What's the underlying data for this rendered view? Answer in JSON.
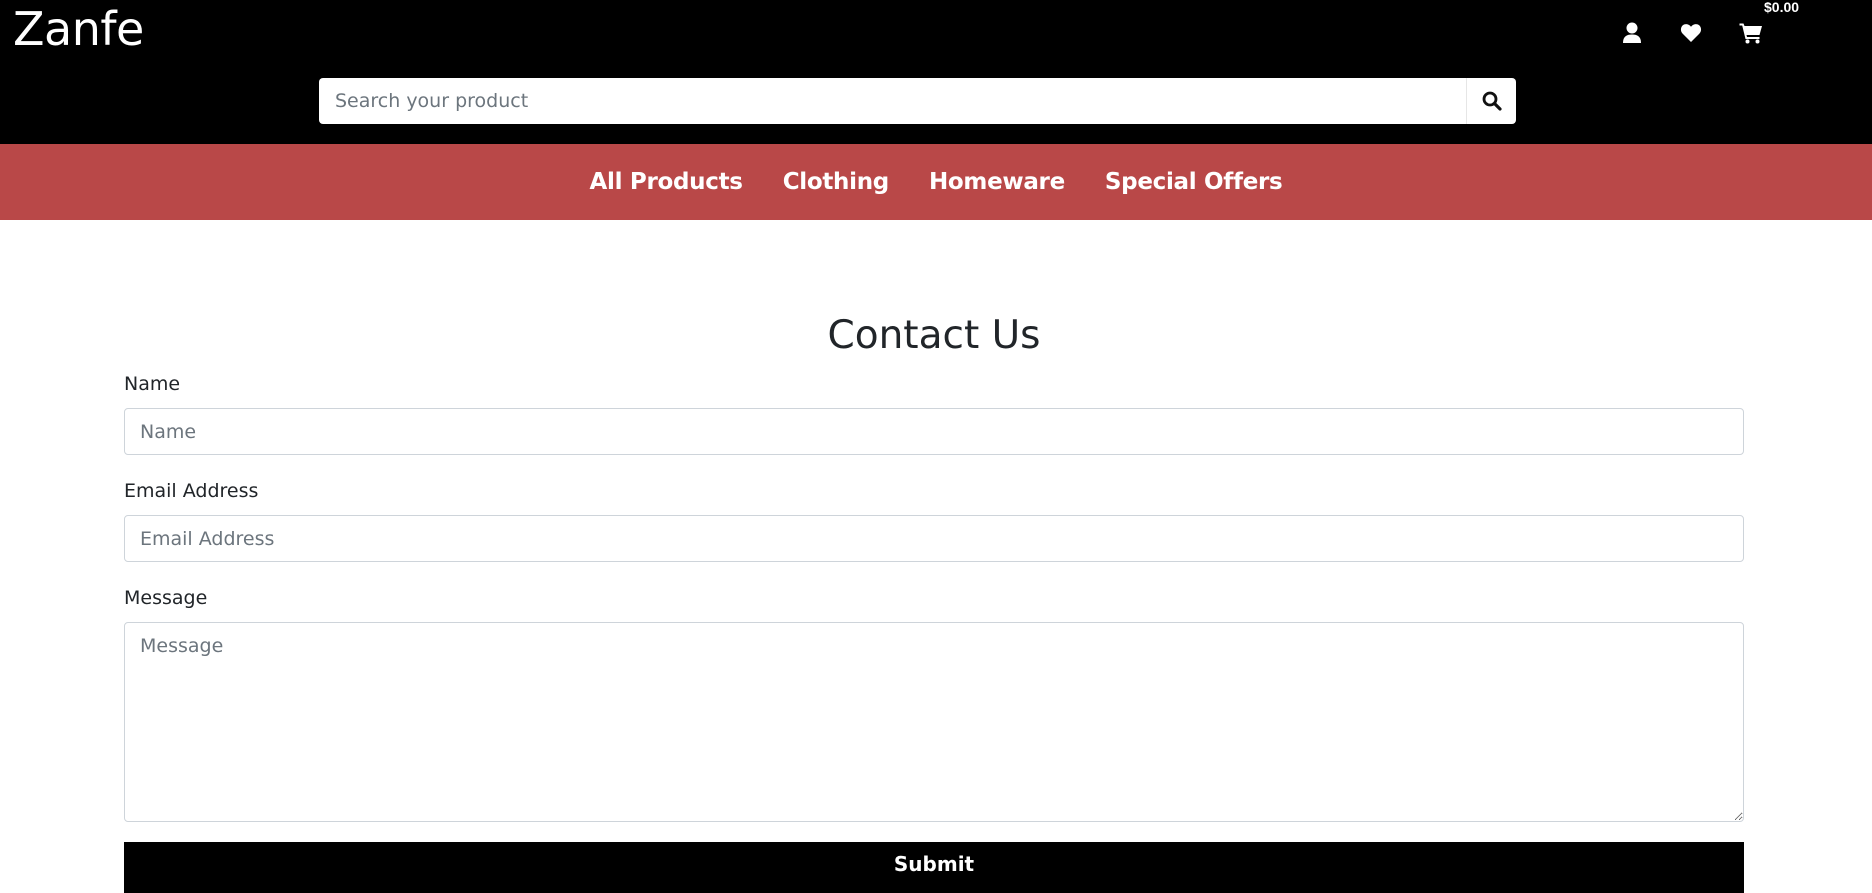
{
  "header": {
    "logo": "Zanfe",
    "cart_total": "$0.00",
    "icons": [
      "user-icon",
      "heart-icon",
      "cart-icon"
    ],
    "background": "#000000"
  },
  "search": {
    "placeholder": "Search your product",
    "value": "",
    "icon": "search-icon"
  },
  "nav": {
    "background": "#b94848",
    "items": [
      {
        "label": "All Products"
      },
      {
        "label": "Clothing"
      },
      {
        "label": "Homeware"
      },
      {
        "label": "Special Offers"
      }
    ]
  },
  "main": {
    "title": "Contact Us",
    "form": {
      "name": {
        "label": "Name",
        "placeholder": "Name",
        "value": ""
      },
      "email": {
        "label": "Email Address",
        "placeholder": "Email Address",
        "value": ""
      },
      "message": {
        "label": "Message",
        "placeholder": "Message",
        "value": ""
      },
      "submit_label": "Submit"
    }
  }
}
